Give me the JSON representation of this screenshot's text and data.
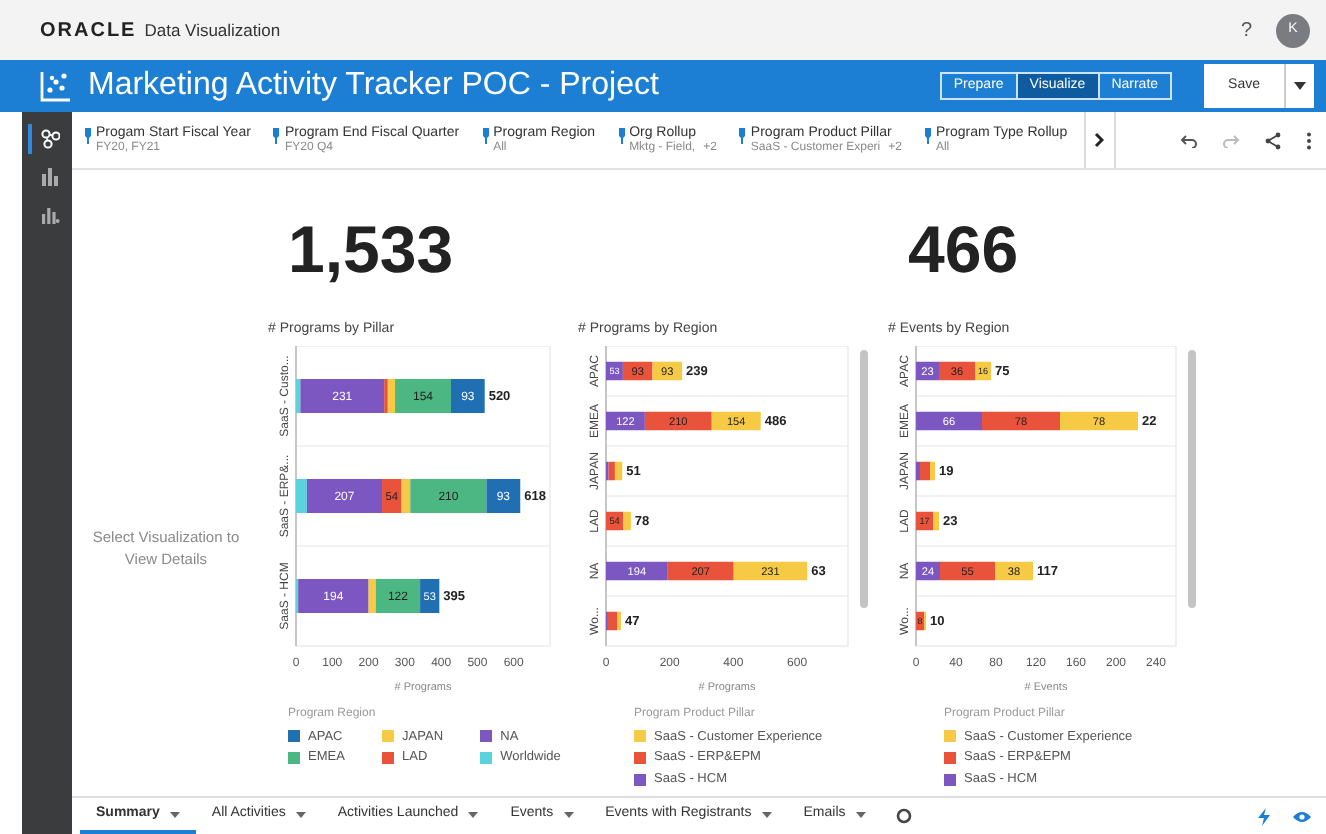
{
  "app": {
    "brand": "ORACLE",
    "product": "Data Visualization",
    "help": "?",
    "avatar": "K"
  },
  "project": {
    "title": "Marketing Activity Tracker POC - Project",
    "modes": [
      {
        "label": "Prepare",
        "selected": false
      },
      {
        "label": "Visualize",
        "selected": true
      },
      {
        "label": "Narrate",
        "selected": false
      }
    ],
    "save": "Save"
  },
  "sidebar": {
    "items": [
      {
        "selected": true
      },
      {
        "selected": false
      },
      {
        "selected": false
      }
    ]
  },
  "filters": [
    {
      "name": "Progam Start Fiscal Year",
      "value": "FY20, FY21"
    },
    {
      "name": "Program End Fiscal Quarter",
      "value": "FY20 Q4"
    },
    {
      "name": "Program Region",
      "value": "All"
    },
    {
      "name": "Org Rollup",
      "value": "Mktg - Field,",
      "more": "+2"
    },
    {
      "name": "Program Product Pillar",
      "value": "SaaS - Customer Experi",
      "more": "+2"
    },
    {
      "name": "Program Type Rollup",
      "value": "All"
    }
  ],
  "kpis": [
    {
      "value": "1,533"
    },
    {
      "value": "466"
    }
  ],
  "details_hint": "Select Visualization to View Details",
  "charts": [
    {
      "scrollable": false,
      "legend_title": "Program Region",
      "totals": [
        "520",
        "618",
        "395"
      ],
      "chart_data": {
        "type": "bar",
        "title": "# Programs by Pillar",
        "orientation": "horizontal",
        "stacked": true,
        "xlabel": "# Programs",
        "categories": [
          "SaaS - Custo...",
          "SaaS - ERP&...",
          "SaaS - HCM"
        ],
        "xlim": [
          0,
          700
        ],
        "xticks": [
          0,
          100,
          200,
          300,
          400,
          500,
          600
        ],
        "series": [
          {
            "name": "Worldwide",
            "color": "#5ad3dd",
            "values": [
              12,
              30,
              6
            ]
          },
          {
            "name": "NA",
            "color": "#7d57c1",
            "values": [
              231,
              207,
              194
            ]
          },
          {
            "name": "LAD",
            "color": "#e9533b",
            "values": [
              10,
              54,
              null
            ]
          },
          {
            "name": "JAPAN",
            "color": "#f7ca45",
            "values": [
              20,
              24,
              20
            ]
          },
          {
            "name": "EMEA",
            "color": "#4cb782",
            "values": [
              154,
              210,
              122
            ]
          },
          {
            "name": "APAC",
            "color": "#1f6fb2",
            "values": [
              93,
              93,
              53
            ]
          }
        ],
        "value_labels": [
          [
            null,
            null,
            null
          ],
          [
            "231",
            "207",
            "194"
          ],
          [
            null,
            "54",
            null
          ],
          [
            null,
            null,
            null
          ],
          [
            "154",
            "210",
            "122"
          ],
          [
            "93",
            "93",
            "53"
          ]
        ]
      }
    },
    {
      "scrollable": true,
      "legend_title": "Program Product Pillar",
      "totals": [
        "239",
        "486",
        "51",
        "78",
        "63",
        "47"
      ],
      "chart_data": {
        "type": "bar",
        "title": "# Programs by Region",
        "orientation": "horizontal",
        "stacked": true,
        "xlabel": "# Programs",
        "categories": [
          "APAC",
          "EMEA",
          "JAPAN",
          "LAD",
          "NA",
          "Wo..."
        ],
        "xlim": [
          0,
          760
        ],
        "xticks": [
          0,
          200,
          400,
          600
        ],
        "series": [
          {
            "name": "SaaS - HCM",
            "color": "#7d57c1",
            "values": [
              53,
              122,
              8,
              null,
              194,
              6
            ]
          },
          {
            "name": "SaaS - ERP&EPM",
            "color": "#e9533b",
            "values": [
              93,
              210,
              20,
              54,
              207,
              30
            ]
          },
          {
            "name": "SaaS - Customer Experience",
            "color": "#f7ca45",
            "values": [
              93,
              154,
              23,
              24,
              231,
              11
            ]
          }
        ],
        "value_labels": [
          [
            "53",
            "122",
            null,
            null,
            "194",
            null
          ],
          [
            "93",
            "210",
            null,
            "54",
            "207",
            null
          ],
          [
            "93",
            "154",
            null,
            null,
            "231",
            null
          ]
        ]
      }
    },
    {
      "scrollable": true,
      "legend_title": "Program Product Pillar",
      "totals": [
        "75",
        "22",
        "19",
        "23",
        "117",
        "10"
      ],
      "chart_data": {
        "type": "bar",
        "title": "# Events by Region",
        "orientation": "horizontal",
        "stacked": true,
        "xlabel": "# Events",
        "categories": [
          "APAC",
          "EMEA",
          "JAPAN",
          "LAD",
          "NA",
          "Wo..."
        ],
        "xlim": [
          0,
          260
        ],
        "xticks": [
          0,
          40,
          80,
          120,
          160,
          200,
          240
        ],
        "series": [
          {
            "name": "SaaS - HCM",
            "color": "#7d57c1",
            "values": [
              23,
              66,
              4,
              null,
              24,
              null
            ]
          },
          {
            "name": "SaaS - ERP&EPM",
            "color": "#e9533b",
            "values": [
              36,
              78,
              10,
              17,
              55,
              8
            ]
          },
          {
            "name": "SaaS - Customer Experience",
            "color": "#f7ca45",
            "values": [
              16,
              78,
              5,
              6,
              38,
              2
            ]
          }
        ],
        "value_labels": [
          [
            "23",
            "66",
            null,
            null,
            "24",
            null
          ],
          [
            "36",
            "78",
            null,
            "17",
            "55",
            "8"
          ],
          [
            "16",
            "78",
            null,
            null,
            "38",
            null
          ]
        ]
      }
    }
  ],
  "sheet_tabs": [
    {
      "label": "Summary",
      "selected": true
    },
    {
      "label": "All Activities",
      "selected": false
    },
    {
      "label": "Activities Launched",
      "selected": false
    },
    {
      "label": "Events",
      "selected": false
    },
    {
      "label": "Events with Registrants",
      "selected": false
    },
    {
      "label": "Emails",
      "selected": false
    }
  ]
}
